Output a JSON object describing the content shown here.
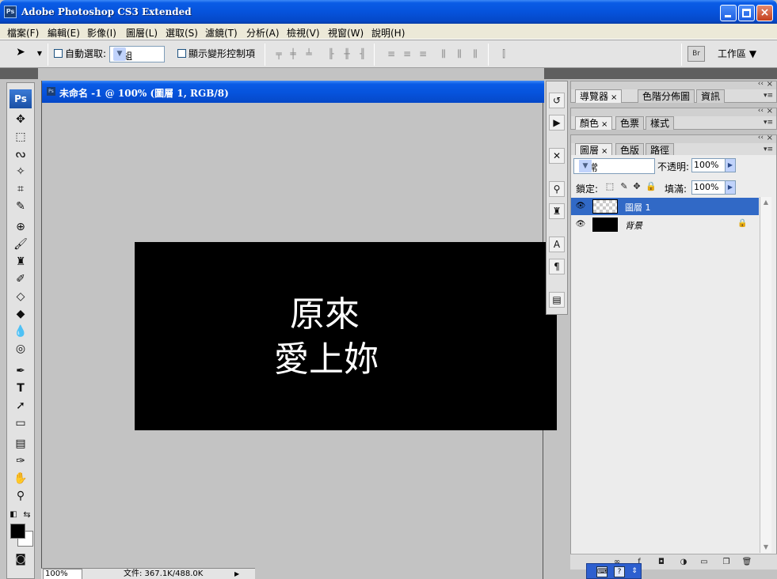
{
  "window": {
    "app_icon": "Ps",
    "title": "Adobe Photoshop CS3 Extended",
    "close_glyph": "×"
  },
  "menu": [
    "檔案(F)",
    "編輯(E)",
    "影像(I)",
    "圖層(L)",
    "選取(S)",
    "濾鏡(T)",
    "分析(A)",
    "檢視(V)",
    "視窗(W)",
    "說明(H)"
  ],
  "options_bar": {
    "auto_select_label": "自動選取:",
    "auto_select_value": "群組",
    "show_transform_label": "顯示變形控制項",
    "bridge_icon": "Br",
    "workspace_label": "工作區 ▼"
  },
  "toolbox": {
    "logo": "Ps"
  },
  "document": {
    "icon": "Ps",
    "title": "未命名 -1 @ 100% (圖層 1, RGB/8)",
    "zoom": "100%",
    "status": "文件: 367.1K/488.0K",
    "canvas_text_line1": "原來",
    "canvas_text_line2": "愛上妳"
  },
  "panels": {
    "group1": {
      "tabs": [
        "導覽器",
        "色階分佈圖",
        "資訊"
      ]
    },
    "group2": {
      "tabs": [
        "顏色",
        "色票",
        "樣式"
      ]
    },
    "layers": {
      "tabs": [
        "圖層",
        "色版",
        "路徑"
      ],
      "blend_mode": "正常",
      "opacity_label": "不透明:",
      "opacity_value": "100%",
      "lock_label": "鎖定:",
      "fill_label": "填滿:",
      "fill_value": "100%",
      "rows": [
        {
          "name": "圖層 1",
          "selected": true
        },
        {
          "name": "背景",
          "selected": false
        }
      ]
    }
  },
  "colors": {
    "title_blue": "#0653dc",
    "selected_layer": "#3169c6",
    "canvas": "#000000"
  }
}
